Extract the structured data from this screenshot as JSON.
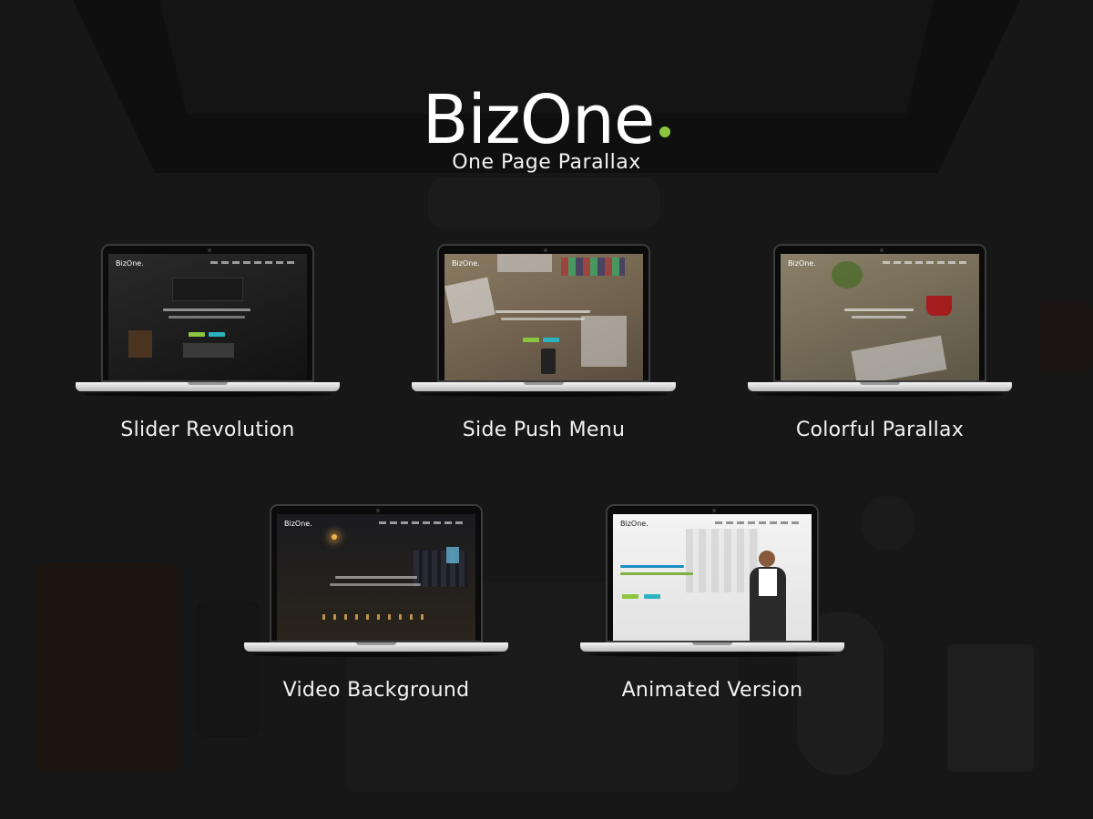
{
  "brand": {
    "title": "BizOne",
    "tagline": "One Page Parallax",
    "accent_color": "#8cc63f"
  },
  "demos": [
    {
      "label": "Slider Revolution",
      "screen_logo": "BizOne."
    },
    {
      "label": "Side Push Menu",
      "screen_logo": "BizOne."
    },
    {
      "label": "Colorful Parallax",
      "screen_logo": "BizOne."
    },
    {
      "label": "Video Background",
      "screen_logo": "BizOne."
    },
    {
      "label": "Animated Version",
      "screen_logo": "BizOne."
    }
  ]
}
